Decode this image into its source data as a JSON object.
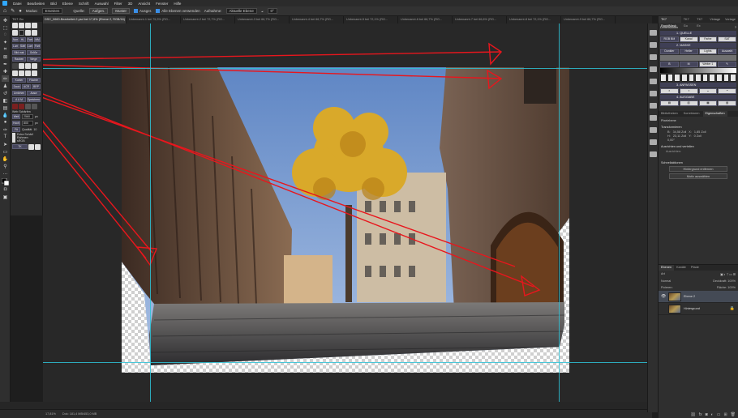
{
  "menubar": {
    "items": [
      "Datei",
      "Bearbeiten",
      "Bild",
      "Ebene",
      "Schrift",
      "Auswahl",
      "Filter",
      "3D",
      "Ansicht",
      "Fenster",
      "Hilfe"
    ]
  },
  "options": {
    "modus_label": "Modus:",
    "modus_value": "Ersetzen",
    "quelle_label": "Quelle:",
    "aufgen_btn": "Aufgen.",
    "muster_btn": "Muster",
    "ausger_label": "Ausger.",
    "alle_ebenen_label": "Alle Ebenen verwenden",
    "aufnahme_label": "Aufnahme:",
    "aufnahme_value": "Aktuelle Ebene",
    "angle_value": "0°"
  },
  "tabs": [
    {
      "label": "DSC_0660-Bearbeitet-2.psd bei 17,8% (Ebene 2, RGB/16) *",
      "active": true
    },
    {
      "label": "Unbenannt-1 bei 75,3% (RG...",
      "active": false
    },
    {
      "label": "Unbenannt-2 bei 72,7% (RG...",
      "active": false
    },
    {
      "label": "Unbenannt-3 bei 66,7% (RG...",
      "active": false
    },
    {
      "label": "Unbenannt-4 bei 66,7% (RG...",
      "active": false
    },
    {
      "label": "Unbenannt-5 bei 72,1% (RG...",
      "active": false
    },
    {
      "label": "Unbenannt-6 bei 66,7% (RG...",
      "active": false
    },
    {
      "label": "Unbenannt-7 bei 66,6% (RG...",
      "active": false
    },
    {
      "label": "Unbenannt-8 bei 72,1% (RG...",
      "active": false
    },
    {
      "label": "Unbenannt-9 bei 66,7% (RG...",
      "active": false
    }
  ],
  "txpanel": {
    "title": "TK7 Go",
    "row1": [
      "Norm",
      "HL",
      "Farbe",
      "MM"
    ],
    "row2": [
      "Lum HL",
      "Sättig",
      "Lum",
      "Farbe"
    ],
    "row3": [
      "Bild mat",
      "Größe"
    ],
    "row4": [
      "Rauben",
      "Wege"
    ],
    "row5": [
      "Konter",
      "Flüchte"
    ],
    "row6": [
      "Dauk",
      "ACR",
      "BRP"
    ],
    "row7": [
      "Umkrhen",
      "Ausw"
    ],
    "row8": [
      "A & M",
      "Speichern"
    ],
    "web_label": "Web Schärfen",
    "width_label": "Weit",
    "width_value": "2560",
    "width_unit": "px",
    "height_label": "Hoch",
    "height_value": "800",
    "height_unit": "px",
    "fit_label": "Fit",
    "quality_label": "Qualität",
    "quality_value": "10",
    "extra_label": "Extra Schärf",
    "rahmen_label": "Rahmen",
    "srgb_label": "sRGB",
    "tk_label": "TK"
  },
  "status": {
    "zoom": "17,81%",
    "doc": "Dok: 181,4 MB/453,0 MB"
  },
  "right_tabs": [
    "TK7 RapidMask",
    "TK7 Go",
    "TK7 Ex",
    "Vintage",
    "Vorlage"
  ],
  "txpro": {
    "header_label": "Dimensionen",
    "section1": "1. QUELLE",
    "row_a": [
      "RGB BM",
      "Kanal",
      "Farbe",
      "SAT"
    ],
    "section2": "2. MASKE",
    "row_b": [
      "Dunkler",
      "Heller",
      "Lights",
      "Auswahl"
    ],
    "row_c": [
      "B",
      "M"
    ],
    "row_d": [
      "Weiter 1"
    ],
    "section3": "3. ANPASSEN",
    "section4": "4. AUSGABE"
  },
  "properties": {
    "tabs": [
      "Bibliotheken",
      "Korrekturen",
      "Eigenschaften"
    ],
    "layer_kind": "Pixelebene",
    "transform_title": "Transformieren",
    "w_label": "B:",
    "w_value": "34,58 Zoll",
    "x_label": "X:",
    "x_value": "1,85 Zoll",
    "h_label": "H:",
    "h_value": "23,11 Zoll",
    "y_label": "Y:",
    "y_value": "0 Zoll",
    "angle": "0,00°",
    "align_title": "Ausrichten und verteilen",
    "align_sub": "Ausrichten:",
    "quick_title": "Schnellaktionen",
    "bg_btn": "Hintergrund entfernen",
    "subject_btn": "Motiv auswählen"
  },
  "layers": {
    "tabs": [
      "Ebenen",
      "Kanäle",
      "Pfade"
    ],
    "kind_label": "Art",
    "blend_mode": "Normal",
    "opacity_label": "Deckkraft:",
    "opacity_value": "100%",
    "lock_label": "Fixieren:",
    "fill_label": "Fläche:",
    "fill_value": "100%",
    "items": [
      {
        "name": "Ebene 2",
        "selected": true
      },
      {
        "name": "Hintergrund",
        "selected": false
      }
    ]
  },
  "colors": {
    "accent": "#31a8ff",
    "guide": "#2ec2d6",
    "arrow": "#e8161d",
    "txbutton": "#46465c"
  },
  "icons": {
    "move": "move-icon",
    "marquee": "marquee-icon",
    "lasso": "lasso-icon",
    "crop": "crop-icon",
    "eyedropper": "eyedropper-icon",
    "brush": "brush-icon",
    "stamp": "stamp-icon",
    "eraser": "eraser-icon",
    "text": "text-icon",
    "zoom": "zoom-icon"
  }
}
